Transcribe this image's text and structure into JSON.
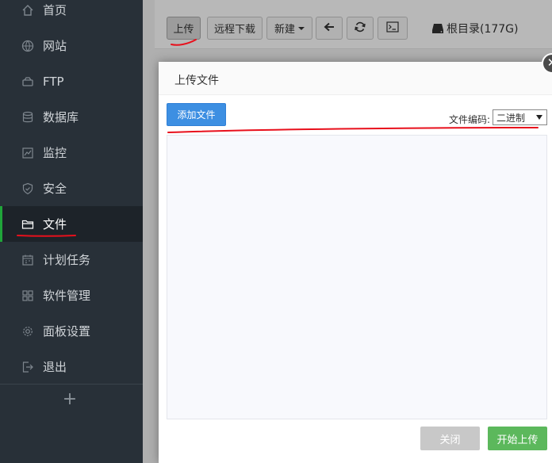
{
  "sidebar": {
    "items": [
      {
        "label": "首页",
        "icon": "home-icon"
      },
      {
        "label": "网站",
        "icon": "globe-icon"
      },
      {
        "label": "FTP",
        "icon": "ftp-icon"
      },
      {
        "label": "数据库",
        "icon": "database-icon"
      },
      {
        "label": "监控",
        "icon": "monitor-icon"
      },
      {
        "label": "安全",
        "icon": "shield-icon"
      },
      {
        "label": "文件",
        "icon": "folder-icon"
      },
      {
        "label": "计划任务",
        "icon": "calendar-icon"
      },
      {
        "label": "软件管理",
        "icon": "grid-icon"
      },
      {
        "label": "面板设置",
        "icon": "gear-icon"
      },
      {
        "label": "退出",
        "icon": "logout-icon"
      }
    ],
    "active_item": "文件",
    "add_label": "+"
  },
  "toolbar": {
    "upload_label": "上传",
    "remote_download_label": "远程下载",
    "new_label": "新建",
    "back_icon": "arrow-left-icon",
    "refresh_icon": "refresh-icon",
    "terminal_icon": "terminal-icon",
    "disk_label": "根目录(177G)"
  },
  "modal": {
    "title": "上传文件",
    "add_file_label": "添加文件",
    "encoding_label": "文件编码:",
    "encoding_value": "二进制",
    "cancel_label": "关闭",
    "start_label": "开始上传",
    "close_icon": "close-icon"
  },
  "colors": {
    "sidebar_bg": "#283038",
    "active_accent": "#20a53a",
    "primary_blue": "#3d8fe2",
    "success_green": "#5cb85c",
    "annotation_red": "#e8101c"
  }
}
